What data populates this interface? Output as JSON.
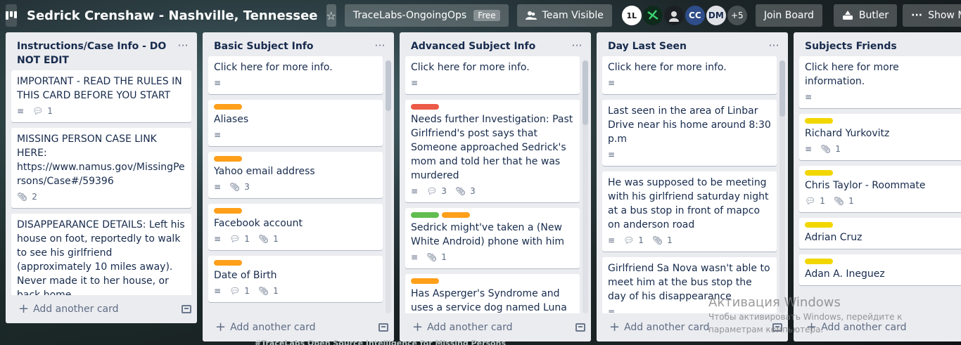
{
  "header": {
    "board_title": "Sedrick Crenshaw - Nashville, Tennessee",
    "team_name": "TraceLabs-OngoingOps",
    "team_badge": "Free",
    "visibility_label": "Team Visible",
    "members": [
      "1L",
      "",
      "",
      "CC",
      "DM"
    ],
    "more_members": "+5",
    "join_board": "Join Board",
    "butler": "Butler",
    "show_menu": "Show Menu"
  },
  "lists": [
    {
      "title": "Instructions/Case Info - DO NOT EDIT",
      "cards": [
        {
          "text": "IMPORTANT - READ THE RULES IN THIS CARD BEFORE YOU START",
          "comments": "1"
        },
        {
          "text": "MISSING PERSON CASE LINK HERE: https://www.namus.gov/MissingPersons/Case#/59396",
          "attachments": "2"
        },
        {
          "text": "DISAPPEARANCE DETAILS: Left his house on foot, reportedly to walk to see his girlfriend (approximately 10 miles away). Never made it to her house, or back home."
        }
      ],
      "add_card": "Add another card"
    },
    {
      "title": "Basic Subject Info",
      "cards": [
        {
          "text": "Click here for more info."
        },
        {
          "text": "Aliases"
        },
        {
          "text": "Yahoo email address",
          "attachments": "3"
        },
        {
          "text": "Facebook account",
          "comments": "1",
          "attachments": "1"
        },
        {
          "text": "Date of Birth",
          "comments": "1",
          "attachments": "1"
        }
      ],
      "add_card": "Add another card"
    },
    {
      "title": "Advanced Subject Info",
      "cards": [
        {
          "text": "Click here for more info."
        },
        {
          "text": "Needs further Investigation: Past Girlfriend's post says that Someone approached Sedrick's mom and told her that he was murdered",
          "comments": "3",
          "attachments": "3"
        },
        {
          "text": "Sedrick might've taken a (New White Android) phone with him",
          "attachments": "1"
        },
        {
          "text": "Has Asperger's Syndrome and uses a service dog named Luna"
        }
      ],
      "add_card": "Add another card"
    },
    {
      "title": "Day Last Seen",
      "cards": [
        {
          "text": "Click here for more info."
        },
        {
          "text": "Last seen in the area of Linbar Drive near his home around 8:30 p.m"
        },
        {
          "text": "He was supposed to be meeting with his girlfriend saturday night at a bus stop in front of mapco on anderson road",
          "comments": "1",
          "attachments": "1"
        },
        {
          "text": "Girlfriend Sa Nova wasn't able to meet him at the bus stop the day of his disappearance"
        }
      ],
      "add_card": "Add another card"
    },
    {
      "title": "Subjects Friends",
      "cards": [
        {
          "text": "Click here for more information."
        },
        {
          "text": "Richard Yurkovitz",
          "attachments": "1"
        },
        {
          "text": "Chris Taylor - Roommate",
          "comments": "1",
          "attachments": "1"
        },
        {
          "text": "Adrian Cruz"
        },
        {
          "text": "Adan A. Ineguez"
        }
      ],
      "add_card": "Add another card"
    }
  ],
  "colors": {
    "orange": "#ff9f1a",
    "red": "#eb5a46",
    "green": "#61bd4f",
    "yellow": "#f2d600"
  },
  "watermark": {
    "title": "Активация Windows",
    "line1": "Чтобы активировать Windows, перейдите к",
    "line2": "параметрам компьютера."
  },
  "bottom_text": "#TraceLabs Open Source Intelligence for Missing Persons"
}
